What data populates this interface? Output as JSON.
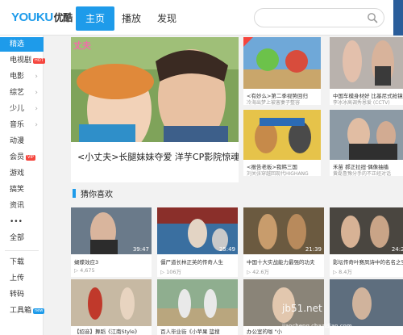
{
  "header": {
    "logo_en": "YOUKU",
    "logo_cn": "优酷",
    "tabs": [
      "主页",
      "播放",
      "发现"
    ]
  },
  "sidebar": {
    "items": [
      {
        "label": "精选",
        "arrow": ""
      },
      {
        "label": "电视剧",
        "badge": "HOT",
        "arrow": ""
      },
      {
        "label": "电影",
        "arrow": "›"
      },
      {
        "label": "综艺",
        "arrow": "›"
      },
      {
        "label": "少儿",
        "arrow": "›"
      },
      {
        "label": "音乐",
        "arrow": "›"
      },
      {
        "label": "动漫",
        "arrow": ""
      },
      {
        "label": "会员",
        "badge": "VIP",
        "arrow": ""
      },
      {
        "label": "游戏",
        "arrow": ""
      },
      {
        "label": "搞笑",
        "arrow": ""
      },
      {
        "label": "资讯",
        "arrow": ""
      },
      {
        "label": "•••",
        "arrow": ""
      },
      {
        "label": "全部",
        "arrow": ""
      }
    ],
    "tools": [
      {
        "label": "下载"
      },
      {
        "label": "上传"
      },
      {
        "label": "转码"
      },
      {
        "label": "工具箱",
        "badge": "new"
      }
    ]
  },
  "hero": {
    "caption": "<小丈夫>长腿妹妹夺爱 洋芋CP影院惊魂",
    "overlay": "丈夫"
  },
  "featured": [
    {
      "title": "<有妙么>第二季视势回归",
      "sub": "冷海出梦上被害妻子整容"
    },
    {
      "title": "中国车模身材好 比基尼式抢镜",
      "sub": "李冰冰高调秀恩爱 (CCTV)"
    },
    {
      "title": "<报告老板>我韩三国",
      "sub": "刘关张穿越回现代HIGHANG"
    },
    {
      "title": "禾苗 郝正拉扭·偶像抽搐",
      "sub": "黄磊鲁豫分手的不正经对话"
    }
  ],
  "section": {
    "title": "猜你喜欢"
  },
  "recommended": [
    {
      "title": "蝴蝶效应3",
      "duration": "39:47",
      "views": "4,675"
    },
    {
      "title": "僵尸道长林正英的传奇人生",
      "duration": "25:49",
      "views": "106万"
    },
    {
      "title": "中国十大实战能力最强的功夫",
      "duration": "21:39",
      "views": "42.6万"
    },
    {
      "title": "影坛传奇叶赛凤诗中的名名之宝",
      "duration": "24:20",
      "views": "8.4万"
    },
    {
      "title": "【招音】舞蹈《江南Style》",
      "duration": "",
      "views": ""
    },
    {
      "title": "百人毕业街《小苹果 篮搜",
      "duration": "",
      "views": ""
    },
    {
      "title": "办公室的咖 \"小",
      "duration": "",
      "views": ""
    },
    {
      "title": "",
      "duration": "",
      "views": ""
    }
  ],
  "watermark": {
    "line1": "jb51.net",
    "line2": "jiaocheng.chazidian.com"
  }
}
